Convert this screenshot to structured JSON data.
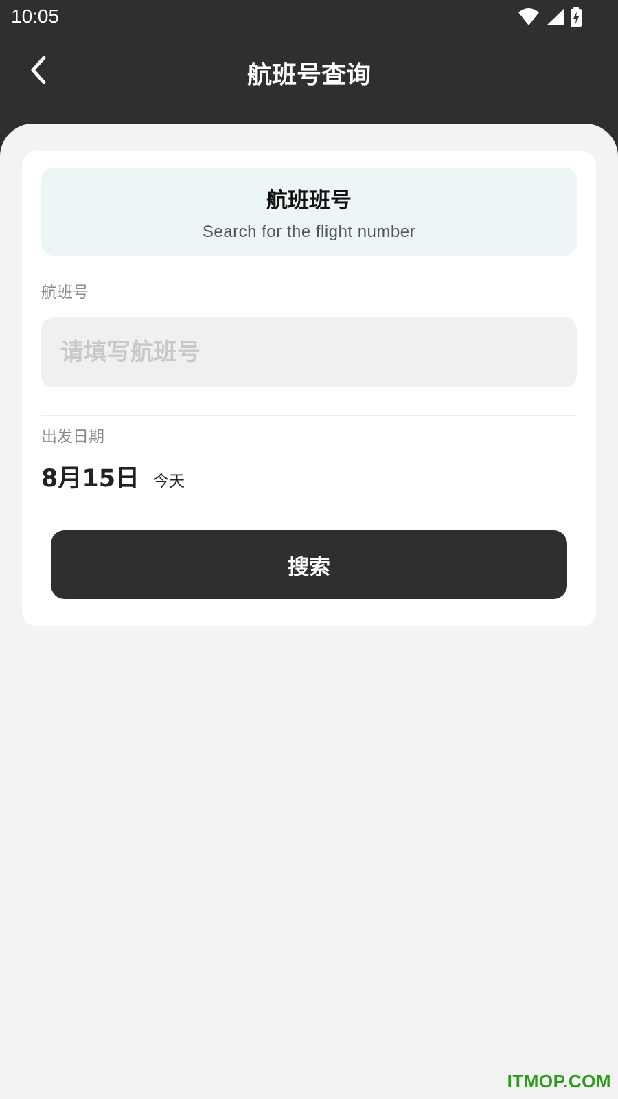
{
  "status_bar": {
    "time": "10:05",
    "icons": [
      "wifi-icon",
      "cellular-signal-icon",
      "battery-charging-icon"
    ]
  },
  "app_bar": {
    "back_icon": "chevron-left-icon",
    "title": "航班号查询"
  },
  "banner": {
    "title": "航班班号",
    "subtitle": "Search for the flight number"
  },
  "flight_field": {
    "label": "航班号",
    "placeholder": "请填写航班号",
    "value": ""
  },
  "date_field": {
    "label": "出发日期",
    "value": "8月15日",
    "note": "今天"
  },
  "search_button": {
    "label": "搜索"
  },
  "watermark": "ITMOP.COM",
  "colors": {
    "header_bg": "#2f2f2f",
    "page_bg": "#f3f3f3",
    "banner_bg": "#edf6f6",
    "button_bg": "#2f2f2f",
    "watermark": "#2e9a1e"
  }
}
